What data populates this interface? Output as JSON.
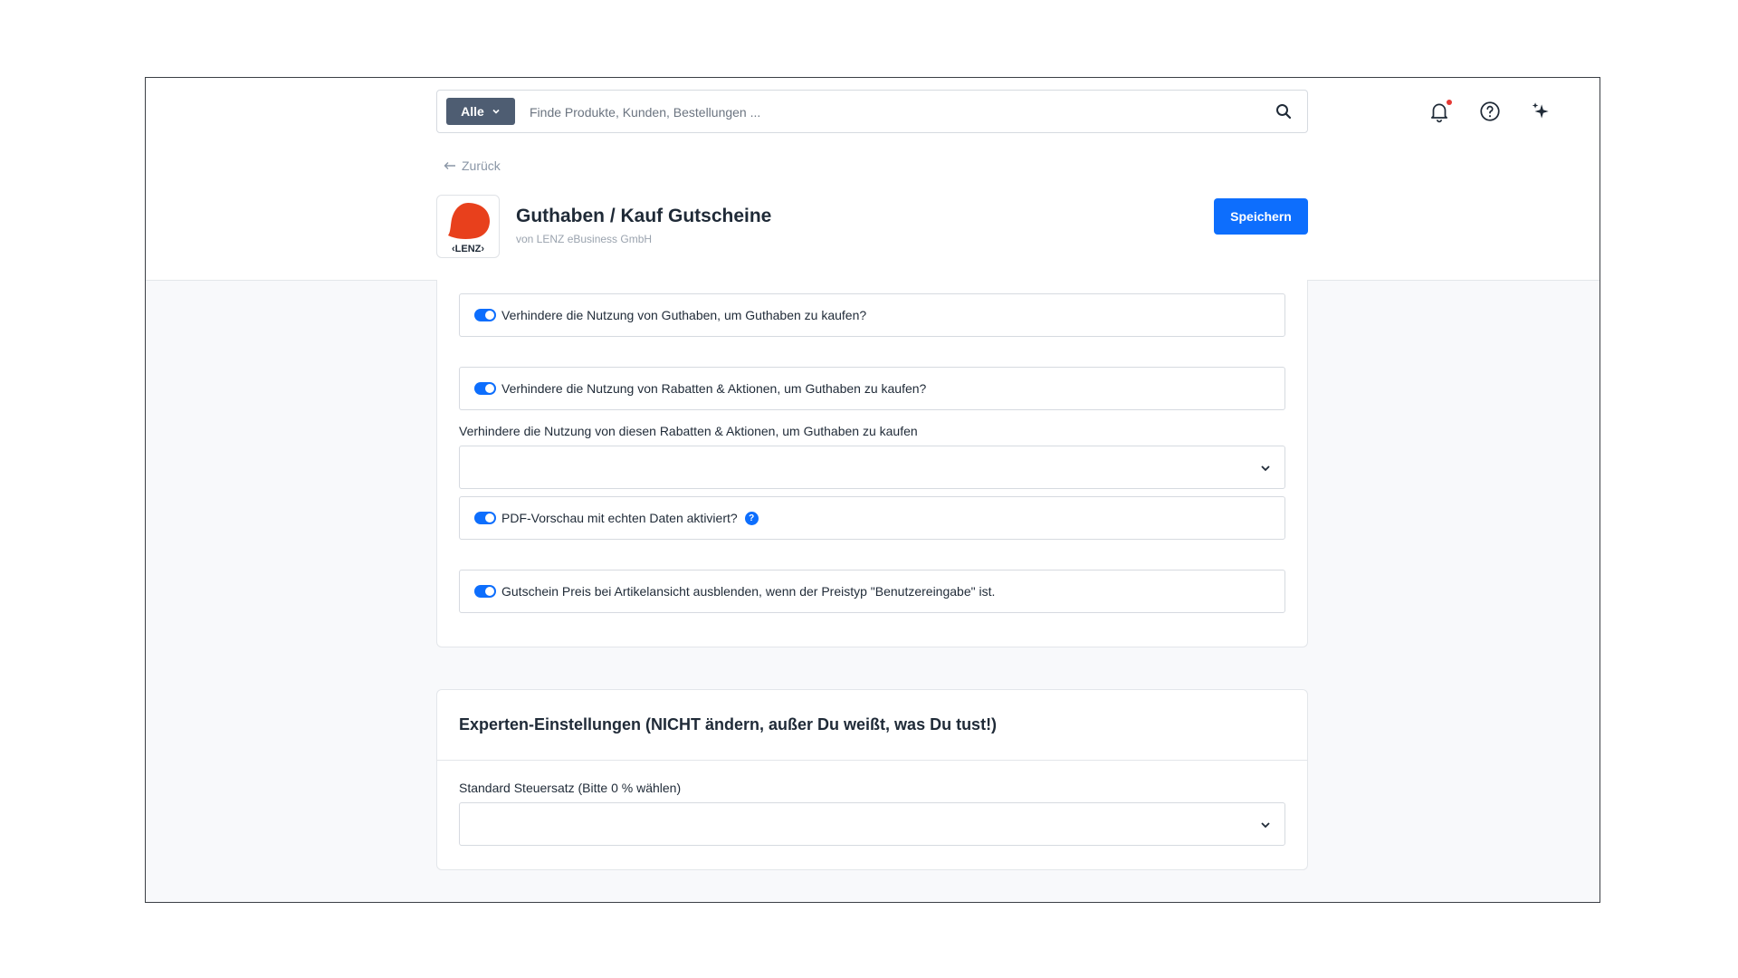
{
  "topbar": {
    "scope_label": "Alle",
    "search_placeholder": "Finde Produkte, Kunden, Bestellungen ..."
  },
  "header": {
    "back_label": "Zurück",
    "title": "Guthaben / Kauf Gutscheine",
    "vendor": "von LENZ eBusiness GmbH",
    "logo_text": "‹LENZ›",
    "save_label": "Speichern"
  },
  "settings": {
    "toggles": [
      {
        "label": "Verhindere die Nutzung von Guthaben, um Guthaben zu kaufen?",
        "enabled": true
      },
      {
        "label": "Verhindere die Nutzung von Rabatten & Aktionen, um Guthaben zu kaufen?",
        "enabled": true
      }
    ],
    "excluded_discounts": {
      "label": "Verhindere die Nutzung von diesen Rabatten & Aktionen, um Guthaben zu kaufen",
      "value": ""
    },
    "pdf_preview": {
      "label": "PDF-Vorschau mit echten Daten aktiviert?",
      "enabled": true,
      "info": "?"
    },
    "hide_price": {
      "label": "Gutschein Preis bei Artikelansicht ausblenden, wenn der Preistyp \"Benutzereingabe\" ist.",
      "enabled": true
    }
  },
  "expert": {
    "title": "Experten-Einstellungen (NICHT ändern, außer Du weißt, was Du tust!)",
    "tax_label": "Standard Steuersatz (Bitte 0 % wählen)",
    "tax_value": ""
  },
  "colors": {
    "primary": "#0d6efd",
    "scope_button": "#4e5d72",
    "logo_red": "#e8401c",
    "notification_dot": "#e53935"
  }
}
